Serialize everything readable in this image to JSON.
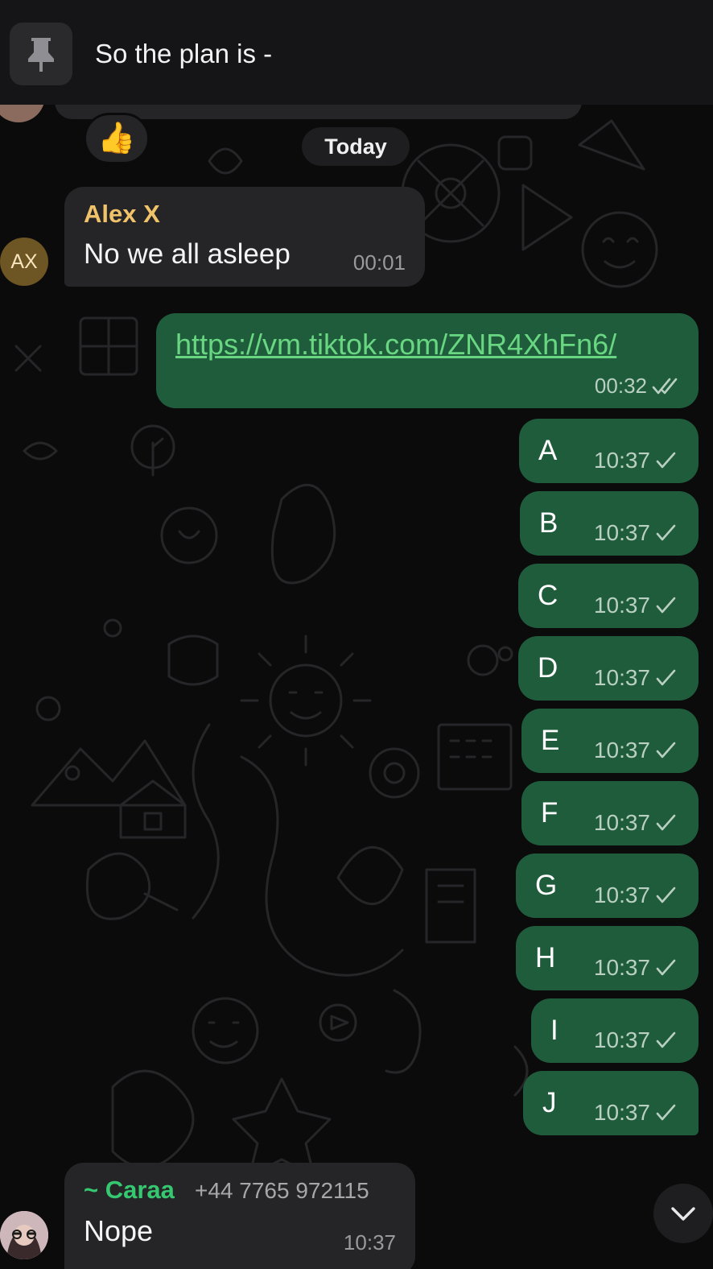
{
  "pinned": {
    "text": "So the plan is -",
    "icon": "pin-icon"
  },
  "reaction": {
    "emoji": "👍",
    "icon": "thumbs-up-icon"
  },
  "date_divider": "Today",
  "messages": {
    "alex": {
      "sender": "Alex X",
      "avatar_initials": "AX",
      "text": "No we all asleep",
      "time": "00:01"
    },
    "link": {
      "text": "https://vm.tiktok.com/ZNR4XhFn6/",
      "time": "00:32",
      "status_icon": "double-check-icon"
    },
    "letters": [
      {
        "text": "A",
        "time": "10:37"
      },
      {
        "text": "B",
        "time": "10:37"
      },
      {
        "text": "C",
        "time": "10:37"
      },
      {
        "text": "D",
        "time": "10:37"
      },
      {
        "text": "E",
        "time": "10:37"
      },
      {
        "text": "F",
        "time": "10:37"
      },
      {
        "text": "G",
        "time": "10:37"
      },
      {
        "text": "H",
        "time": "10:37"
      },
      {
        "text": "I",
        "time": "10:37"
      },
      {
        "text": "J",
        "time": "10:37"
      }
    ],
    "caraa": {
      "sender": "~ Caraa",
      "phone": "+44 7765 972115",
      "text": "Nope",
      "time": "10:37"
    }
  },
  "scroll_button_icon": "chevron-down-icon",
  "colors": {
    "background": "#0b0b0c",
    "outgoing_bubble": "#1f5c3c",
    "incoming_bubble": "#252527",
    "link": "#69d782",
    "alex_name": "#f0c36a",
    "caraa_name": "#35c870"
  }
}
